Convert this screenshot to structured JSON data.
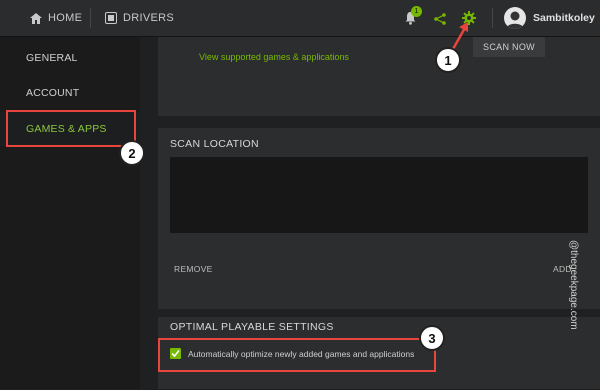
{
  "nav": {
    "home_label": "HOME",
    "drivers_label": "DRIVERS",
    "notification_count": "1",
    "username": "Sambitkoley"
  },
  "sidebar": {
    "items": [
      {
        "label": "GENERAL"
      },
      {
        "label": "ACCOUNT"
      },
      {
        "label": "GAMES & APPS"
      }
    ]
  },
  "top_panel": {
    "link_text": "View supported games & applications",
    "scan_now_label": "SCAN NOW"
  },
  "scan_location": {
    "title": "SCAN LOCATION",
    "remove_label": "REMOVE",
    "add_label": "ADD"
  },
  "optimal": {
    "title": "OPTIMAL PLAYABLE SETTINGS",
    "checkbox_label": "Automatically optimize newly added games and applications",
    "checked": true
  },
  "callouts": [
    "1",
    "2",
    "3"
  ],
  "watermark": "@thegeekpage.com",
  "colors": {
    "accent": "#76b900",
    "callout": "#e8453c"
  }
}
